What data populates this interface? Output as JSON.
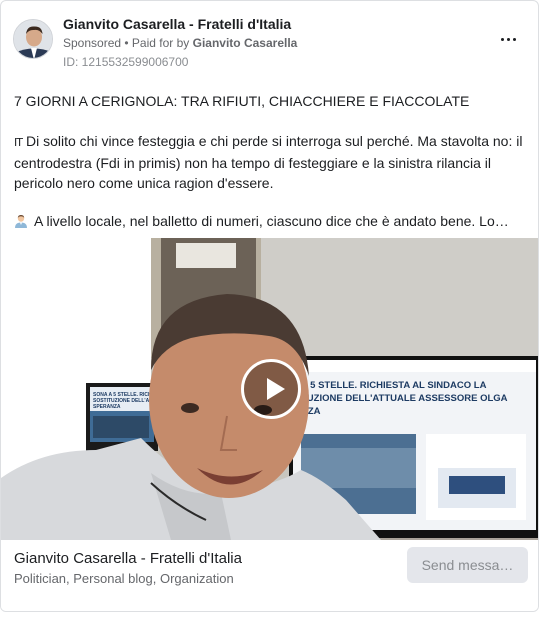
{
  "header": {
    "page_name": "Gianvito Casarella - Fratelli d'Italia",
    "sponsored": "Sponsored",
    "separator": " • ",
    "paid_for_prefix": "Paid for by ",
    "paid_for_name": "Gianvito Casarella",
    "ad_id": "ID: 1215532599006700",
    "more_icon": "more-horizontal-icon"
  },
  "post": {
    "headline": "7 GIORNI A CERIGNOLA: TRA RIFIUTI, CHIACCHIERE E FIACCOLATE",
    "flag_glyph": "IT",
    "paragraph_1": "Di solito chi vince festeggia e chi perde si interroga sul perché. Ma stavolta no: il centrodestra (Fdi in primis) non ha tempo di festeggiare e la sinistra rilancia il pericolo nero come unica ragion d'essere.",
    "person_icon": "person-emoji-icon",
    "paragraph_2": "A livello locale, nel balletto di numeri, ciascuno dice che è andato bene. Lo…"
  },
  "media": {
    "play_icon": "play-icon",
    "screen_headline": "A 5 STELLE. RICHIESTA AL SINDACO LA\nTUZIONE DELL'ATTUALE ASSESSORE OLGA\nNZA",
    "left_screen_text": "SONA A 5 STELLE. RICH\nSOSTITUZIONE DELL'A\nSPERANZA"
  },
  "footer": {
    "page_name": "Gianvito Casarella - Fratelli d'Italia",
    "categories": "Politician, Personal blog, Organization",
    "send_button": "Send messa…"
  }
}
